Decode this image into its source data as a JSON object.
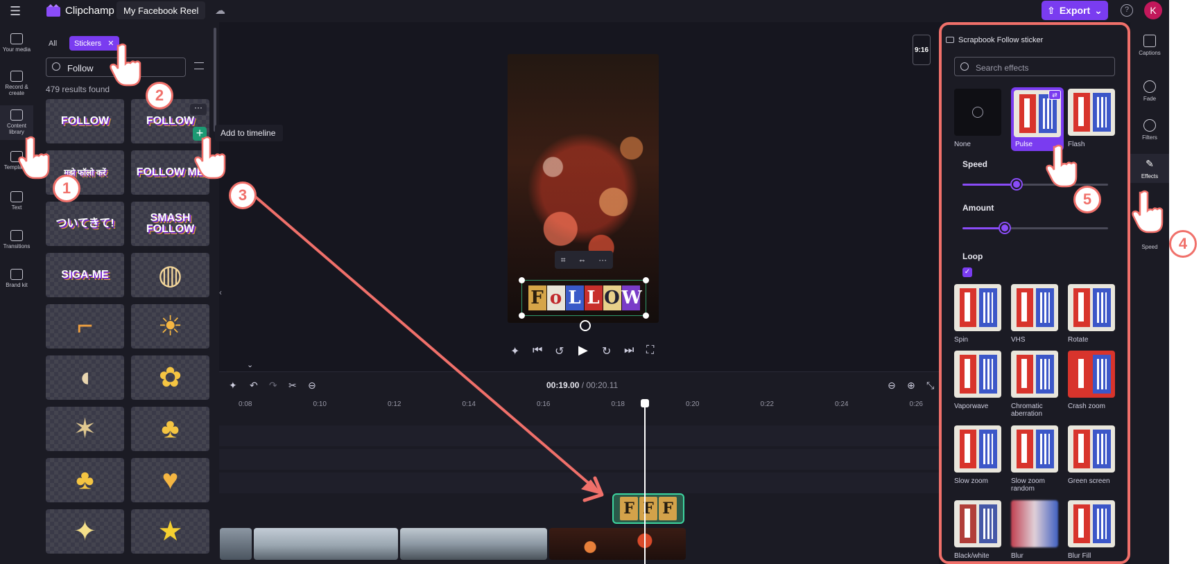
{
  "topbar": {
    "app_name": "Clipchamp",
    "project_title": "My Facebook Reel",
    "export_label": "Export",
    "export_caret": "⌄",
    "help_glyph": "?",
    "avatar_initial": "K"
  },
  "left_rail": {
    "items": [
      {
        "label": "Your media",
        "icon": "folder-icon"
      },
      {
        "label": "Record & create",
        "icon": "camera-icon"
      },
      {
        "label": "Content library",
        "icon": "content-library-icon"
      },
      {
        "label": "Templates",
        "icon": "templates-icon"
      },
      {
        "label": "Text",
        "icon": "text-icon"
      },
      {
        "label": "Transitions",
        "icon": "transitions-icon"
      },
      {
        "label": "Brand kit",
        "icon": "brand-kit-icon"
      }
    ]
  },
  "library": {
    "filter_all": "All",
    "filter_active": "Stickers",
    "search_value": "Follow",
    "results_text": "479 results found",
    "tooltip": "Add to timeline",
    "tiles": [
      "FOLLOW",
      "FOLLOW",
      "मुझे फॉलो करें",
      "FOLLOW ME",
      "ついてきて!",
      "SMASH FOLLOW",
      "SIGA-ME",
      "",
      "",
      "",
      "",
      "",
      "",
      "",
      "",
      "",
      "",
      ""
    ]
  },
  "preview": {
    "ratio": "9:16",
    "sticker_letters": [
      "F",
      "o",
      "L",
      "L",
      "O",
      "W"
    ]
  },
  "timeline": {
    "current_time": "00:19.00",
    "duration": "/ 00:20.11",
    "ruler": [
      "0:08",
      "0:10",
      "0:12",
      "0:14",
      "0:16",
      "0:18",
      "0:20",
      "0:22",
      "0:24",
      "0:26"
    ],
    "clip_letters": [
      "F",
      "F",
      "F"
    ]
  },
  "effects": {
    "title": "Scrapbook Follow sticker",
    "search_placeholder": "Search effects",
    "presets": [
      "None",
      "Pulse",
      "Flash",
      "Spin",
      "VHS",
      "Rotate",
      "Vaporwave",
      "Chromatic aberration",
      "Crash zoom",
      "Slow zoom",
      "Slow zoom random",
      "Green screen",
      "Black/white",
      "Blur",
      "Blur Fill"
    ],
    "selected_preset": "Pulse",
    "speed_label": "Speed",
    "speed_value": 0.37,
    "amount_label": "Amount",
    "amount_value": 0.29,
    "loop_label": "Loop",
    "loop_checked": true
  },
  "right_rail": {
    "items": [
      "Captions",
      "Fade",
      "Filters",
      "Effects",
      "Speed"
    ]
  },
  "annotations": {
    "badges": [
      "1",
      "2",
      "3",
      "4",
      "5"
    ]
  },
  "colors": {
    "accent": "#7a3cf0",
    "highlight": "#f0706a",
    "success": "#1c9a73"
  }
}
